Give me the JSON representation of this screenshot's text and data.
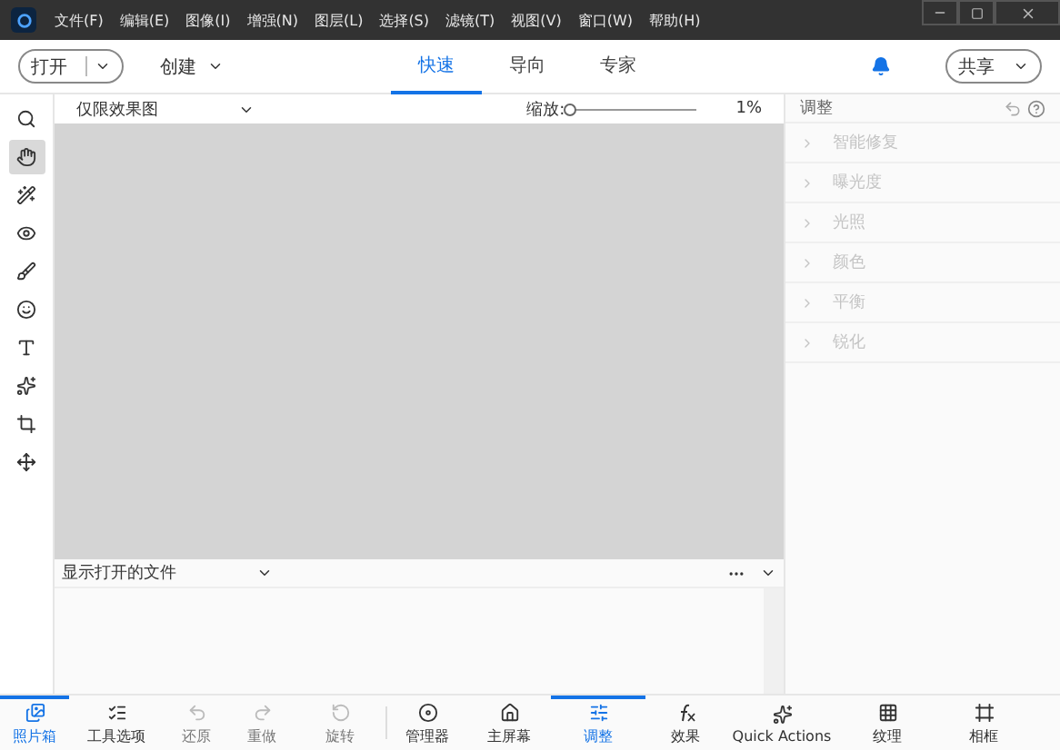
{
  "menu": [
    "文件(F)",
    "编辑(E)",
    "图像(I)",
    "增强(N)",
    "图层(L)",
    "选择(S)",
    "滤镜(T)",
    "视图(V)",
    "窗口(W)",
    "帮助(H)"
  ],
  "toolbar": {
    "open": "打开",
    "create": "创建",
    "share": "共享"
  },
  "modes": [
    {
      "label": "快速",
      "selected": true
    },
    {
      "label": "导向",
      "selected": false
    },
    {
      "label": "专家",
      "selected": false
    }
  ],
  "tools": [
    {
      "kind": "zoom",
      "selected": false
    },
    {
      "kind": "hand",
      "selected": true
    },
    {
      "kind": "select",
      "selected": false
    },
    {
      "kind": "eye",
      "selected": false
    },
    {
      "kind": "brush",
      "selected": false
    },
    {
      "kind": "whiten",
      "selected": false
    },
    {
      "kind": "text",
      "selected": false
    },
    {
      "kind": "spot",
      "selected": false
    },
    {
      "kind": "crop",
      "selected": false
    },
    {
      "kind": "move",
      "selected": false
    }
  ],
  "view": {
    "mode": "仅限效果图",
    "zoom_label": "缩放:",
    "zoom": {
      "level": 0.0,
      "reading": "1%"
    }
  },
  "photo_bin": {
    "title": "显示打开的文件"
  },
  "panel": {
    "title": "调整",
    "items": [
      {
        "label": "智能修复",
        "disabled": true
      },
      {
        "label": "曝光度",
        "disabled": true
      },
      {
        "label": "光照",
        "disabled": true
      },
      {
        "label": "颜色",
        "disabled": true
      },
      {
        "label": "平衡",
        "disabled": true
      },
      {
        "label": "锐化",
        "disabled": true
      }
    ]
  },
  "bottom_bar": [
    {
      "kind": "bin",
      "label": "照片箱",
      "selected": true,
      "disabled": false
    },
    {
      "kind": "options",
      "label": "工具选项",
      "selected": false,
      "disabled": false
    },
    {
      "kind": "undo",
      "label": "还原",
      "selected": false,
      "disabled": true
    },
    {
      "kind": "redo",
      "label": "重做",
      "selected": false,
      "disabled": true
    },
    {
      "kind": "rotate",
      "label": "旋转",
      "selected": false,
      "disabled": true
    },
    {
      "kind": "organizer",
      "label": "管理器",
      "selected": false,
      "disabled": false
    },
    {
      "kind": "home",
      "label": "主屏幕",
      "selected": false,
      "disabled": false
    },
    {
      "kind": "adjust",
      "label": "调整",
      "selected": true,
      "disabled": false
    },
    {
      "kind": "fx",
      "label": "效果",
      "selected": false,
      "disabled": false
    },
    {
      "kind": "sparkle",
      "label": "Quick Actions",
      "selected": false,
      "disabled": false
    },
    {
      "kind": "texture",
      "label": "纹理",
      "selected": false,
      "disabled": false
    },
    {
      "kind": "frame",
      "label": "相框",
      "selected": false,
      "disabled": false
    }
  ]
}
